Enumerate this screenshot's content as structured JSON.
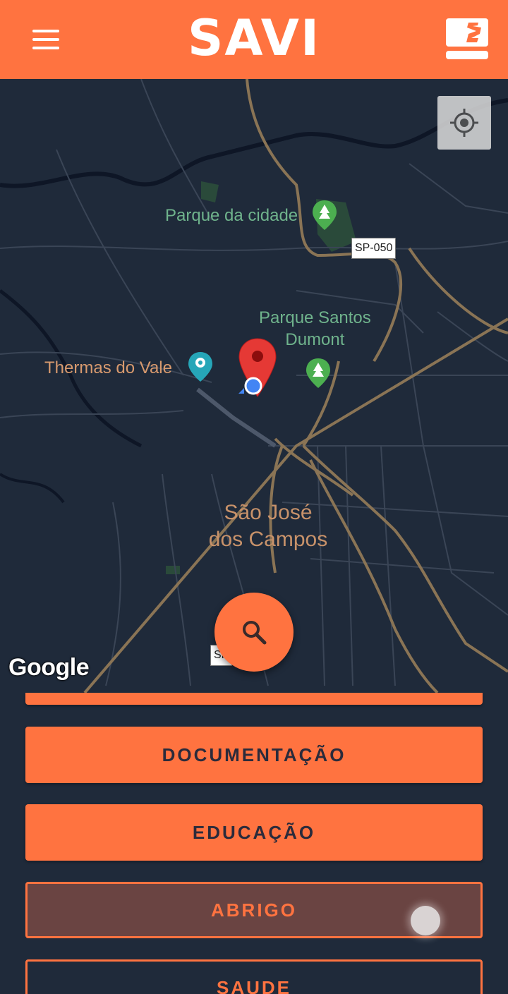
{
  "theme": {
    "accent": "#ff7340",
    "map_bg": "#1f2a3a"
  },
  "header": {
    "menu_icon": "hamburger-menu-icon",
    "app_title": "SAVI",
    "right_icon": "seat-logo-icon"
  },
  "map": {
    "labels": {
      "parque_cidade": "Parque da cidade",
      "parque_santos": "Parque Santos\nDumont",
      "thermas": "Thermas do Vale",
      "city_line1": "São José",
      "city_line2": "dos Campos",
      "road_sp050": "SP-050",
      "road_partial": "SP"
    },
    "attribution": "Google",
    "locate_icon": "my-location-icon",
    "search_icon": "search-icon",
    "marker_icon": "red-map-pin-icon"
  },
  "categories": [
    {
      "label": "DOCUMENTAÇÃO",
      "style": "filled"
    },
    {
      "label": "EDUCAÇÃO",
      "style": "filled"
    },
    {
      "label": "ABRIGO",
      "style": "outline-pressed"
    },
    {
      "label": "SAUDE",
      "style": "outline"
    }
  ]
}
